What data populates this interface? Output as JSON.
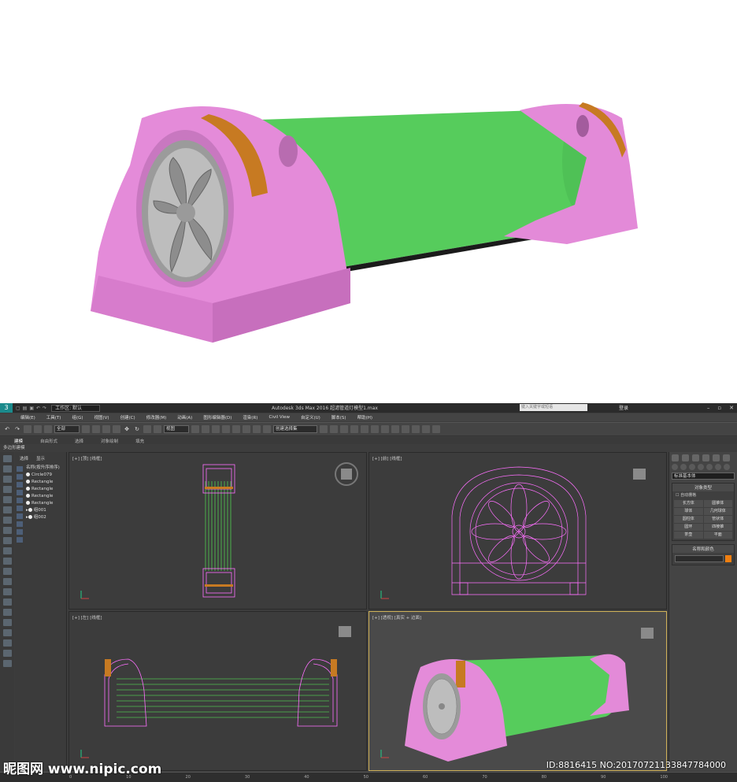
{
  "titlebar": {
    "workspace": "工作区: 默认",
    "app_title": "Autodesk 3ds Max 2016    超滤管道灯模型1.max",
    "search_placeholder": "键入关键字或短语",
    "login": "登录"
  },
  "menu": [
    "编辑(E)",
    "工具(T)",
    "组(G)",
    "视图(V)",
    "创建(C)",
    "修改器(M)",
    "动画(A)",
    "图形编辑器(D)",
    "渲染(R)",
    "Civil View",
    "自定义(U)",
    "脚本(S)",
    "帮助(H)"
  ],
  "toolbar": {
    "filter": "全部",
    "ref_coord": "视图",
    "selection_set": "创建选择集"
  },
  "ribbon_tabs": [
    "建模",
    "自由形式",
    "选择",
    "对象绘制",
    "填充"
  ],
  "ribbon_sub": "多边形建模",
  "scene_explorer": {
    "tabs": [
      "选择",
      "显示"
    ],
    "header": "名称(按升序排序)",
    "items": [
      "Circle079",
      "Rectangle",
      "Rectangle",
      "Rectangle",
      "Rectangle",
      "组001",
      "组002"
    ]
  },
  "viewports": {
    "top": "[+] [顶] [线框]",
    "front": "[+] [前] [线框]",
    "left": "[+] [左] [线框]",
    "persp": "[+] [透视] [真实 + 边面]"
  },
  "command_panel": {
    "dropdown": "标准基本体",
    "object_type_title": "对象类型",
    "autogrid": "自动栅格",
    "buttons": [
      "长方体",
      "圆锥体",
      "球体",
      "几何球体",
      "圆柱体",
      "管状体",
      "圆环",
      "四棱锥",
      "茶壶",
      "平面"
    ],
    "name_color_title": "名称和颜色",
    "swatch_color": "#f07f10"
  },
  "timeline": {
    "ticks": [
      "0",
      "10",
      "20",
      "30",
      "40",
      "50",
      "60",
      "70",
      "80",
      "90",
      "100"
    ]
  },
  "watermark": {
    "site": "昵图网 www.nipic.com",
    "id": "ID:8816415 NO:20170721133847784000"
  },
  "colors": {
    "pink": "#e58fdb",
    "green": "#56cc5c",
    "orange": "#c77a22",
    "wire_pink": "#ff70ff",
    "wire_green": "#58ff58"
  }
}
